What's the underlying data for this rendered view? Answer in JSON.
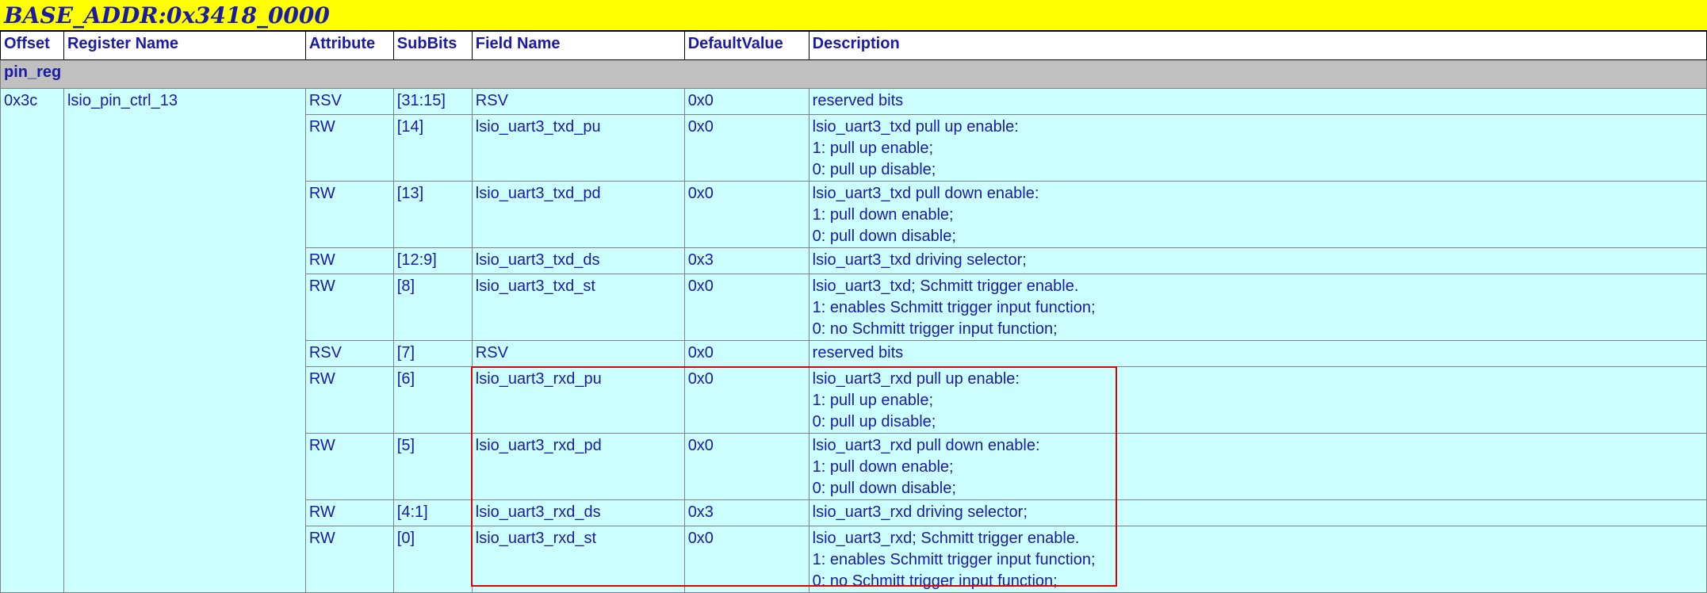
{
  "title": "BASE_ADDR:0x3418_0000",
  "columns": [
    "Offset",
    "Register Name",
    "Attribute",
    "SubBits",
    "Field Name",
    "DefaultValue",
    "Description"
  ],
  "group": "pin_reg",
  "register": {
    "offset": "0x3c",
    "name": "lsio_pin_ctrl_13"
  },
  "rows": [
    {
      "attr": "RSV",
      "bits": "[31:15]",
      "field": "RSV",
      "default": "0x0",
      "desc": [
        "reserved bits"
      ]
    },
    {
      "attr": "RW",
      "bits": "[14]",
      "field": "lsio_uart3_txd_pu",
      "default": "0x0",
      "desc": [
        "lsio_uart3_txd pull up enable:",
        "1: pull up enable;",
        "0: pull up disable;"
      ]
    },
    {
      "attr": "RW",
      "bits": "[13]",
      "field": "lsio_uart3_txd_pd",
      "default": "0x0",
      "desc": [
        "lsio_uart3_txd pull down enable:",
        "1: pull down enable;",
        "0: pull down disable;"
      ]
    },
    {
      "attr": "RW",
      "bits": "[12:9]",
      "field": "lsio_uart3_txd_ds",
      "default": "0x3",
      "desc": [
        "lsio_uart3_txd driving selector;"
      ]
    },
    {
      "attr": "RW",
      "bits": "[8]",
      "field": "lsio_uart3_txd_st",
      "default": "0x0",
      "desc": [
        "lsio_uart3_txd; Schmitt trigger enable.",
        "1: enables Schmitt trigger input function;",
        "0: no Schmitt trigger input function;"
      ]
    },
    {
      "attr": "RSV",
      "bits": "[7]",
      "field": "RSV",
      "default": "0x0",
      "desc": [
        "reserved bits"
      ]
    },
    {
      "attr": "RW",
      "bits": "[6]",
      "field": "lsio_uart3_rxd_pu",
      "default": "0x0",
      "desc": [
        "lsio_uart3_rxd pull up enable:",
        "1: pull up enable;",
        "0: pull up disable;"
      ]
    },
    {
      "attr": "RW",
      "bits": "[5]",
      "field": "lsio_uart3_rxd_pd",
      "default": "0x0",
      "desc": [
        "lsio_uart3_rxd pull down enable:",
        "1: pull down enable;",
        "0: pull down disable;"
      ]
    },
    {
      "attr": "RW",
      "bits": "[4:1]",
      "field": "lsio_uart3_rxd_ds",
      "default": "0x3",
      "desc": [
        "lsio_uart3_rxd driving selector;"
      ]
    },
    {
      "attr": "RW",
      "bits": "[0]",
      "field": "lsio_uart3_rxd_st",
      "default": "0x0",
      "desc": [
        "lsio_uart3_rxd; Schmitt trigger enable.",
        "1: enables Schmitt trigger input function;",
        "0: no Schmitt trigger input function;"
      ]
    }
  ],
  "colors": {
    "title_bg": "#ffff00",
    "text": "#1a1aa6",
    "group_bg": "#c0c0c0",
    "row_bg": "#ccffff",
    "highlight": "#e00000"
  }
}
